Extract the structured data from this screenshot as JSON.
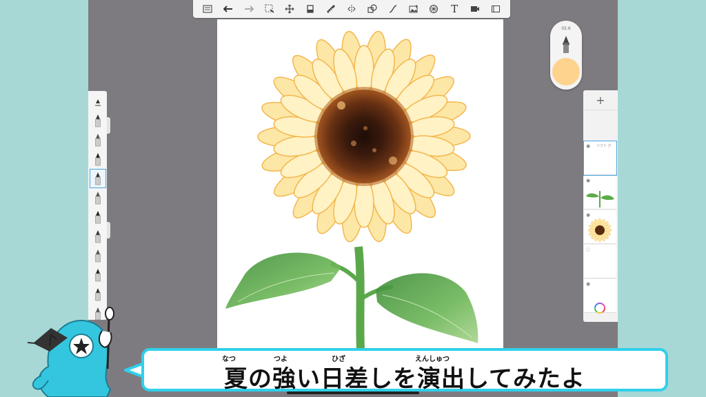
{
  "toolbar": {
    "items": [
      {
        "name": "layout-icon"
      },
      {
        "name": "undo-icon"
      },
      {
        "name": "redo-icon"
      },
      {
        "name": "selection-icon"
      },
      {
        "name": "transform-icon"
      },
      {
        "name": "fill-icon"
      },
      {
        "name": "ruler-icon"
      },
      {
        "name": "symmetry-icon"
      },
      {
        "name": "shape-icon"
      },
      {
        "name": "curve-icon"
      },
      {
        "name": "image-import-icon"
      },
      {
        "name": "perspective-icon"
      },
      {
        "name": "text-tool",
        "label": "T"
      },
      {
        "name": "video-icon"
      },
      {
        "name": "fullscreen-icon"
      }
    ]
  },
  "brush_palette": {
    "selected_index": 3,
    "brushes": [
      "pencil",
      "pencil",
      "marker",
      "marker",
      "pen",
      "pen",
      "brush",
      "brush",
      "airbrush",
      "eraser",
      "smudge"
    ]
  },
  "brush_puck": {
    "size_value": "02.6",
    "color": "#fdd38e"
  },
  "layers": {
    "add_label": "+",
    "items": [
      {
        "name": "ソフト グ",
        "visible": true,
        "selected": true
      },
      {
        "name": "",
        "visible": true,
        "selected": false,
        "thumb": "leaves"
      },
      {
        "name": "",
        "visible": true,
        "selected": false,
        "thumb": "sunflower"
      },
      {
        "name": "",
        "visible": false,
        "selected": false
      },
      {
        "name": "",
        "visible": true,
        "selected": false
      }
    ]
  },
  "subtitle": {
    "text": "夏の強い日差しを演出してみたよ",
    "furigana": [
      {
        "ruby": "なつ"
      },
      {
        "ruby": "つよ"
      },
      {
        "ruby": "ひざ"
      },
      {
        "ruby": "えんしゅつ"
      }
    ]
  },
  "colors": {
    "background": "#a8d8d6",
    "workspace": "#7e7b80",
    "subtitle_border": "#2fd0ea",
    "mascot": "#35c6df",
    "petal": "#fde7a6",
    "petal_edge": "#f3b64d",
    "leaf": "#5cab4a",
    "center": "#5a2a10"
  }
}
